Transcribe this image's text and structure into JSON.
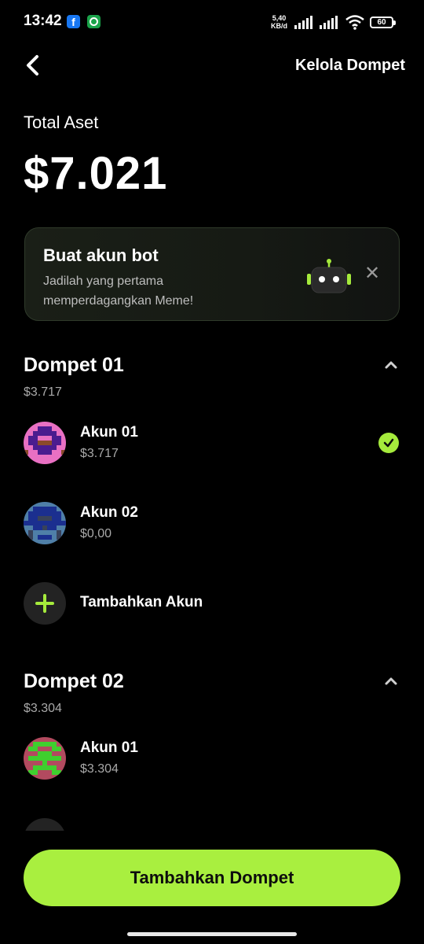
{
  "status_bar": {
    "time": "13:42",
    "facebook_glyph": "f",
    "net_speed_value": "5,40",
    "net_speed_unit": "KB/d",
    "battery": "60"
  },
  "header": {
    "title": "Kelola Dompet"
  },
  "summary": {
    "label": "Total Aset",
    "value": "$7.021"
  },
  "promo": {
    "title": "Buat akun bot",
    "description": "Jadilah yang pertama memperdagangkan Meme!",
    "close_glyph": "✕"
  },
  "wallets": [
    {
      "name": "Dompet 01",
      "value": "$3.717",
      "accounts": [
        {
          "name": "Akun 01",
          "value": "$3.717",
          "selected": true
        },
        {
          "name": "Akun 02",
          "value": "$0,00",
          "selected": false
        }
      ],
      "add_account_label": "Tambahkan Akun"
    },
    {
      "name": "Dompet 02",
      "value": "$3.304",
      "accounts": [
        {
          "name": "Akun 01",
          "value": "$3.304",
          "selected": false
        }
      ]
    }
  ],
  "primary_button": {
    "label": "Tambahkan Dompet"
  },
  "colors": {
    "accent": "#a9ef3f",
    "background": "#000000",
    "muted_text": "#a9a9a9"
  },
  "icons": [
    "back-arrow-icon",
    "robot-icon",
    "close-icon",
    "chevron-up-icon",
    "check-icon",
    "plus-icon"
  ]
}
